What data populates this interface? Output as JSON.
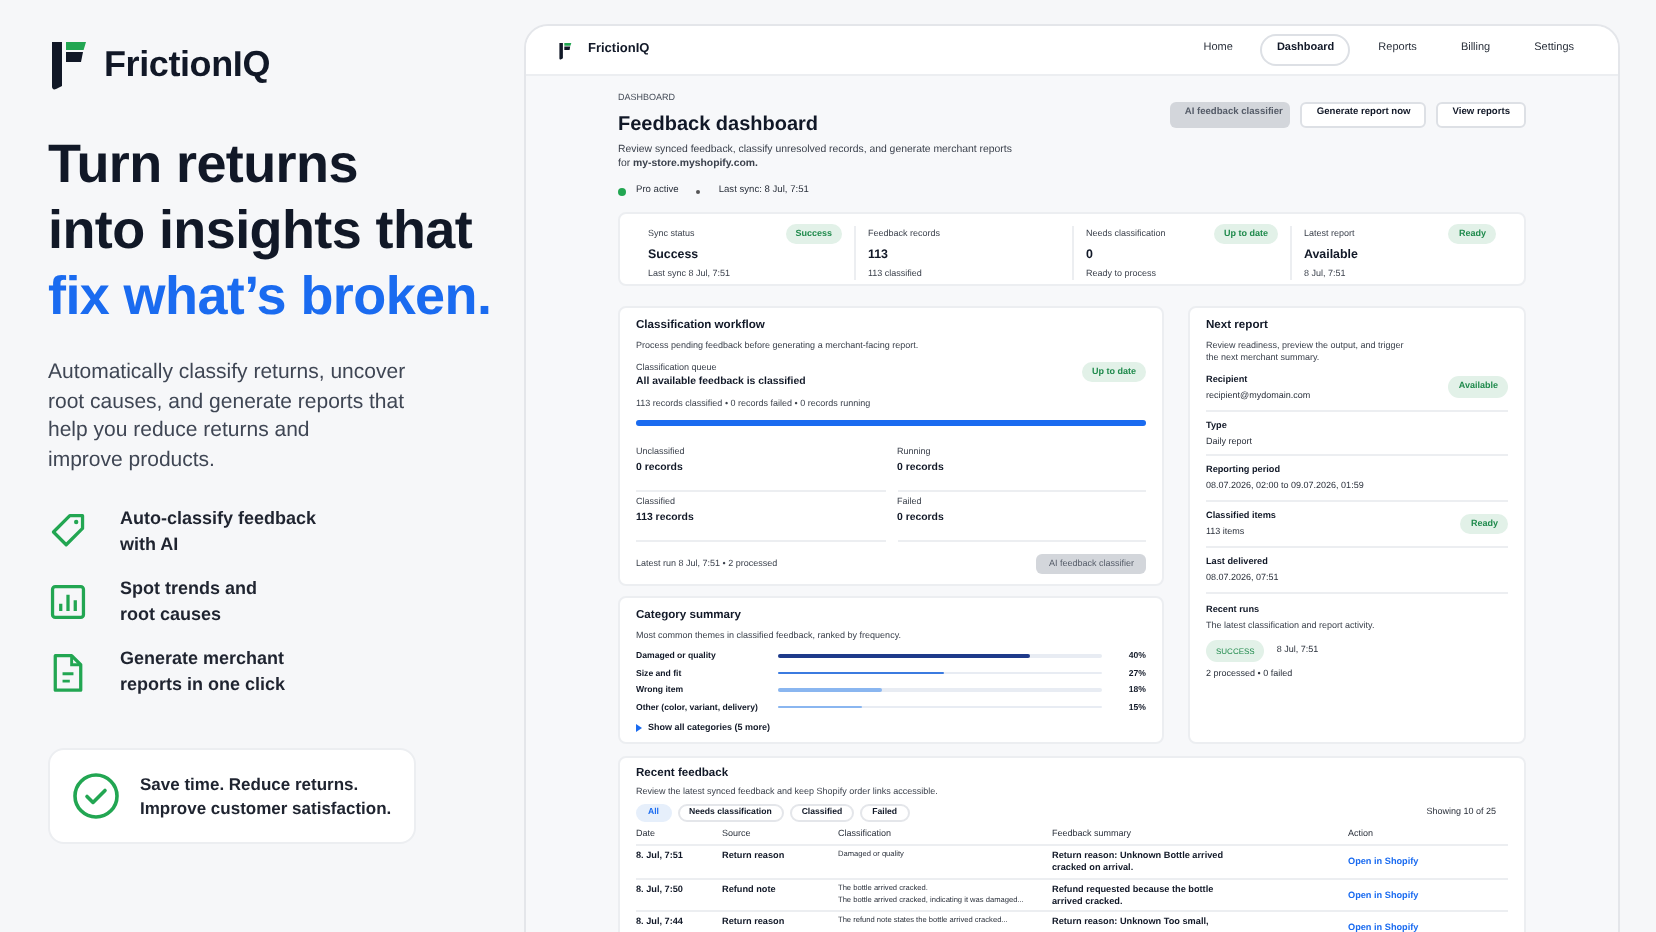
{
  "brand": {
    "name": "FrictionIQ"
  },
  "hero": {
    "headline_lines": [
      "Turn returns",
      "into insights that"
    ],
    "headline_highlight": "fix what’s broken.",
    "description_lines": [
      "Automatically classify returns, uncover",
      "root causes, and generate reports that",
      "help you reduce returns and",
      "improve products."
    ]
  },
  "features": [
    {
      "lines": [
        "Auto-classify feedback",
        "with AI"
      ]
    },
    {
      "lines": [
        "Spot trends and",
        "root causes"
      ]
    },
    {
      "lines": [
        "Generate merchant",
        "reports in one click"
      ]
    }
  ],
  "callout": {
    "lines": [
      "Save time. Reduce returns.",
      "Improve customer satisfaction."
    ]
  },
  "app": {
    "brand": "FrictionIQ",
    "nav": [
      {
        "label": "Home",
        "selected": false
      },
      {
        "label": "Dashboard",
        "selected": true
      },
      {
        "label": "Reports",
        "selected": false
      },
      {
        "label": "Billing",
        "selected": false
      },
      {
        "label": "Settings",
        "selected": false
      }
    ]
  },
  "dashboard": {
    "eyebrow": "DASHBOARD",
    "title": "Feedback dashboard",
    "description": "Review synced feedback, classify unresolved records, and generate merchant reports for **my-store.myshopify.com.**",
    "plan_status": "Pro active",
    "last_sync": "Last sync: 8 Jul, 7:51",
    "buttons": [
      {
        "label": "AI feedback classifier",
        "disabled": true
      },
      {
        "label": "Generate report now",
        "disabled": false
      },
      {
        "label": "View reports",
        "disabled": false
      }
    ]
  },
  "stats": [
    {
      "label": "Sync status",
      "badge": "Success",
      "value": "Success",
      "detail": "Last sync 8 Jul, 7:51"
    },
    {
      "label": "Feedback records",
      "value": "113",
      "detail": "113 classified"
    },
    {
      "label": "Needs classification",
      "badge": "Up to date",
      "value": "0",
      "detail": "Ready to process"
    },
    {
      "label": "Latest report",
      "badge": "Ready",
      "value": "Available",
      "detail": "8 Jul, 7:51"
    }
  ],
  "workflow": {
    "title": "Classification workflow",
    "description": "Process pending feedback before generating a merchant-facing report.",
    "queue_label": "Classification queue",
    "queue_title": "All available feedback is classified",
    "badge": "Up to date",
    "queue_detail": "113 records classified • 0 records failed • 0 records running",
    "progress": {
      "level": 1
    },
    "metrics": [
      {
        "label": "Unclassified",
        "value": "0 records"
      },
      {
        "label": "Running",
        "value": "0 records"
      },
      {
        "label": "Classified",
        "value": "113 records"
      },
      {
        "label": "Failed",
        "value": "0 records"
      }
    ],
    "footer": "Latest run 8 Jul, 7:51 • 2 processed",
    "button": {
      "label": "AI feedback classifier",
      "disabled": true
    }
  },
  "next_report": {
    "title": "Next report",
    "description": "Review readiness, preview the output, and trigger the next merchant summary.",
    "fields": [
      {
        "label": "Recipient",
        "value": "recipient@mydomain.com",
        "badge": "Available"
      },
      {
        "label": "Type",
        "value": "Daily report"
      },
      {
        "label": "Reporting period",
        "value": "08.07.2026, 02:00 to 09.07.2026, 01:59"
      },
      {
        "label": "Classified items",
        "value": "113 items",
        "badge": "Ready"
      },
      {
        "label": "Last delivered",
        "value": "08.07.2026, 07:51"
      }
    ],
    "recent_runs": {
      "title": "Recent runs",
      "description": "The latest classification and report activity.",
      "badge": "SUCCESS",
      "time": "8 Jul, 7:51",
      "detail": "2 processed • 0 failed"
    }
  },
  "category_summary": {
    "title": "Category summary",
    "description": "Most common themes in classified feedback, ranked by frequency.",
    "items": [
      {
        "label": "Damaged or quality",
        "value": "40%",
        "level": 0.78,
        "color": "#1e3a8a"
      },
      {
        "label": "Size and fit",
        "value": "27%",
        "level": 0.51,
        "color": "#3b7be0"
      },
      {
        "label": "Wrong item",
        "value": "18%",
        "level": 0.32,
        "color": "#8ab6f0"
      },
      {
        "label": "Other (color, variant, delivery)",
        "value": "15%",
        "level": 0.26,
        "color": "#8ab6f0"
      }
    ],
    "show_all": "Show all categories (5 more)"
  },
  "recent_feedback": {
    "title": "Recent feedback",
    "description": "Review the latest synced feedback and keep Shopify order links accessible.",
    "filters": [
      {
        "label": "All",
        "selected": true
      },
      {
        "label": "Needs classification",
        "selected": false
      },
      {
        "label": "Classified",
        "selected": false
      },
      {
        "label": "Failed",
        "selected": false
      }
    ],
    "count": "Showing 10 of 25",
    "columns": [
      "Date",
      "Source",
      "Classification",
      "Feedback summary",
      "Action"
    ],
    "rows": [
      {
        "date": "8. Jul, 7:51",
        "source": "Return reason",
        "classification": [
          "Damaged or quality"
        ],
        "summary": "Return reason: Unknown Bottle arrived cracked on arrival.",
        "action": "Open in Shopify"
      },
      {
        "date": "8. Jul, 7:50",
        "source": "Refund note",
        "classification": [
          "The bottle arrived cracked.",
          "The bottle arrived cracked, indicating it was damaged..."
        ],
        "summary": "Refund requested because the bottle arrived cracked.",
        "action": "Open in Shopify"
      },
      {
        "date": "8. Jul, 7:44",
        "source": "Return reason",
        "classification": [
          "The refund note states the bottle arrived cracked..."
        ],
        "summary": "Return reason: Unknown Too small,",
        "action": "Open in Shopify"
      }
    ]
  }
}
